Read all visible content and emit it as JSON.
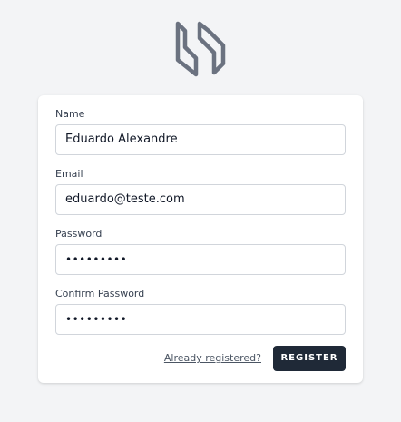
{
  "logo": {
    "icon": "app-logo-icon",
    "color": "#6b7280"
  },
  "form": {
    "name": {
      "label": "Name",
      "value": "Eduardo Alexandre"
    },
    "email": {
      "label": "Email",
      "value": "eduardo@teste.com"
    },
    "password": {
      "label": "Password",
      "value": "•••••••••"
    },
    "confirm_password": {
      "label": "Confirm Password",
      "value": "•••••••••"
    }
  },
  "actions": {
    "login_link": "Already registered?",
    "register_label": "REGISTER"
  },
  "colors": {
    "background": "#f3f4f6",
    "card": "#ffffff",
    "button": "#1f2937",
    "input_border": "#d1d5db"
  }
}
